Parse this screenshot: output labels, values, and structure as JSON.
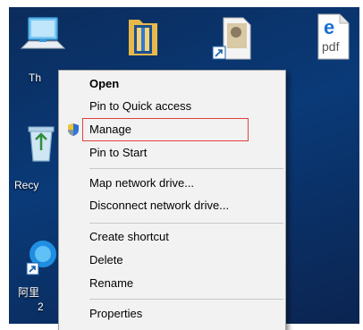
{
  "desktop": {
    "icons": [
      {
        "name": "this-pc-icon",
        "label": "Th"
      },
      {
        "name": "recycle-bin-icon",
        "label": "Recy"
      },
      {
        "name": "app-shortcut-icon",
        "label": "阿里",
        "sublabel": "2"
      },
      {
        "name": "folder-icon",
        "label": ""
      },
      {
        "name": "file-shortcut-icon",
        "label": ""
      },
      {
        "name": "pdf-file-icon",
        "label": "pdf"
      }
    ]
  },
  "context_menu": {
    "items": [
      {
        "label": "Open",
        "bold": true
      },
      {
        "label": "Pin to Quick access"
      },
      {
        "label": "Manage",
        "icon": "shield-icon",
        "highlighted": true
      },
      {
        "label": "Pin to Start"
      },
      {
        "label": "Map network drive..."
      },
      {
        "label": "Disconnect network drive..."
      },
      {
        "label": "Create shortcut"
      },
      {
        "label": "Delete"
      },
      {
        "label": "Rename"
      },
      {
        "label": "Properties"
      }
    ]
  },
  "colors": {
    "menu_bg": "#f2f2f2",
    "highlight_border": "#e0403a",
    "desktop_bg": "#0a3a78"
  }
}
